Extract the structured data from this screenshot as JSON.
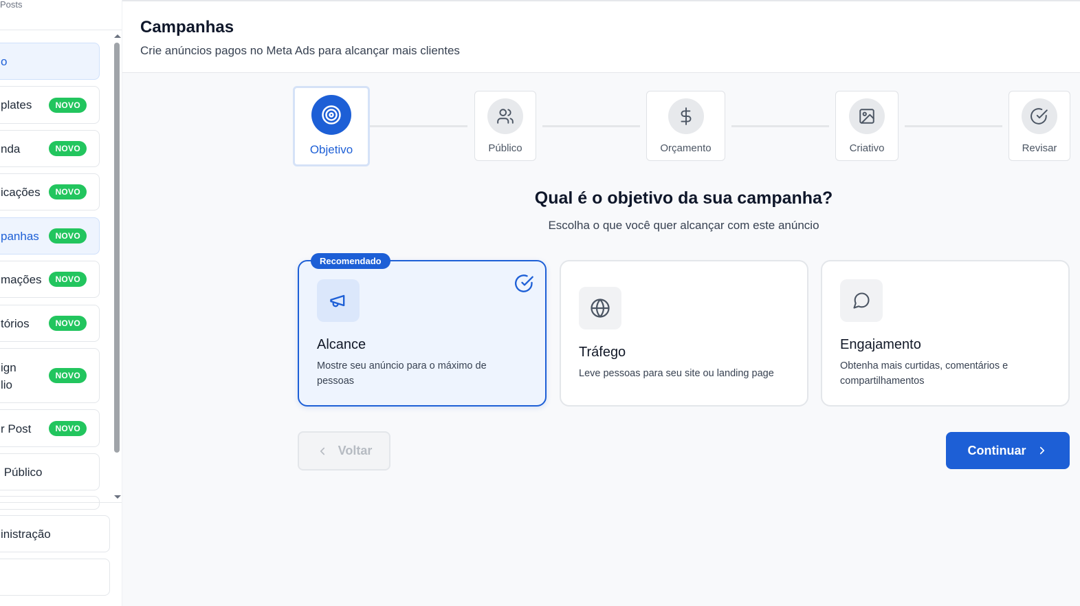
{
  "sidebar": {
    "top_label": "Posts",
    "items": [
      {
        "label": "o",
        "badge": "",
        "active": true
      },
      {
        "label": "plates",
        "badge": "NOVO"
      },
      {
        "label": "nda",
        "badge": "NOVO"
      },
      {
        "label": "icações",
        "badge": "NOVO"
      },
      {
        "label": "panhas",
        "badge": "NOVO",
        "active": true
      },
      {
        "label": "mações",
        "badge": "NOVO"
      },
      {
        "label": "tórios",
        "badge": "NOVO"
      },
      {
        "label": "ign",
        "label2": "lio",
        "badge": "NOVO"
      },
      {
        "label": "r Post",
        "badge": "NOVO"
      },
      {
        "label": " Público",
        "badge": ""
      }
    ],
    "bottom_items": [
      {
        "label": "inistração"
      },
      {
        "label": ""
      }
    ]
  },
  "header": {
    "title": "Campanhas",
    "subtitle": "Crie anúncios pagos no Meta Ads para alcançar mais clientes"
  },
  "stepper": {
    "steps": [
      {
        "label": "Objetivo",
        "icon": "target-icon",
        "active": true
      },
      {
        "label": "Público",
        "icon": "users-icon"
      },
      {
        "label": "Orçamento",
        "icon": "dollar-icon"
      },
      {
        "label": "Criativo",
        "icon": "image-icon"
      },
      {
        "label": "Revisar",
        "icon": "check-circle-icon"
      }
    ]
  },
  "question": {
    "title": "Qual é o objetivo da sua campanha?",
    "subtitle": "Escolha o que você quer alcançar com este anúncio"
  },
  "objectives": [
    {
      "title": "Alcance",
      "desc": "Mostre seu anúncio para o máximo de pessoas",
      "icon": "megaphone-icon",
      "badge": "Recomendado",
      "selected": true
    },
    {
      "title": "Tráfego",
      "desc": "Leve pessoas para seu site ou landing page",
      "icon": "globe-icon"
    },
    {
      "title": "Engajamento",
      "desc": "Obtenha mais curtidas, comentários e compartilhamentos",
      "icon": "message-circle-icon"
    }
  ],
  "actions": {
    "back_label": "Voltar",
    "continue_label": "Continuar"
  },
  "colors": {
    "accent": "#1d5fd6",
    "badge_green": "#22c55e",
    "background": "#f8f9fb"
  }
}
